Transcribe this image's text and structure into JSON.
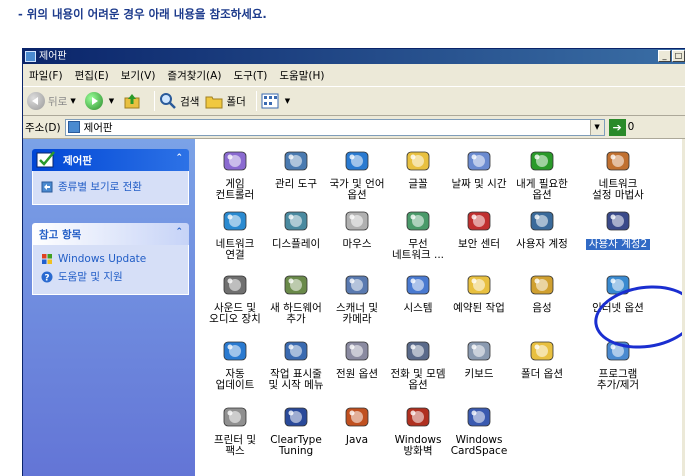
{
  "instruction": "- 위의 내용이 어려운 경우 아래 내용을 참조하세요.",
  "window": {
    "title": "제어판",
    "title_buttons": [
      "_",
      "□"
    ]
  },
  "menubar": [
    "파일(F)",
    "편집(E)",
    "보기(V)",
    "즐겨찾기(A)",
    "도구(T)",
    "도움말(H)"
  ],
  "toolbar": {
    "back": "뒤로",
    "search": "검색",
    "folders": "폴더"
  },
  "address": {
    "label": "주소(D)",
    "value": "제어판",
    "go_label": "0"
  },
  "sidebar": {
    "control_panel": {
      "title": "제어판",
      "links": [
        {
          "label": "종류별 보기로 전환",
          "icon": "category-view-icon"
        }
      ]
    },
    "see_also": {
      "title": "참고 항목",
      "links": [
        {
          "label": "Windows Update",
          "icon": "windows-update-icon"
        },
        {
          "label": "도움말 및 지원",
          "icon": "help-icon"
        }
      ]
    }
  },
  "icons": [
    {
      "label": "게임\n컨트롤러",
      "icon": "game-controller-icon",
      "color": "#8a6ad0"
    },
    {
      "label": "관리 도구",
      "icon": "admin-tools-icon",
      "color": "#4a7ab0"
    },
    {
      "label": "국가 및 언어\n옵션",
      "icon": "globe-icon",
      "color": "#2a7ad0"
    },
    {
      "label": "글꼴",
      "icon": "fonts-folder-icon",
      "color": "#e8c040"
    },
    {
      "label": "날짜 및 시간",
      "icon": "clock-icon",
      "color": "#6a8ad0"
    },
    {
      "label": "내게 필요한\n옵션",
      "icon": "accessibility-icon",
      "color": "#2a9a2a"
    },
    {
      "label": "네트워크\n설정 마법사",
      "icon": "network-setup-icon",
      "color": "#c07030"
    },
    {
      "label": "네트워크\n연결",
      "icon": "network-connections-icon",
      "color": "#2a8ad0"
    },
    {
      "label": "디스플레이",
      "icon": "display-icon",
      "color": "#4a8aa0"
    },
    {
      "label": "마우스",
      "icon": "mouse-icon",
      "color": "#b0b0b0"
    },
    {
      "label": "무선\n네트워크 ...",
      "icon": "wireless-network-icon",
      "color": "#4a9a6a"
    },
    {
      "label": "보안 센터",
      "icon": "security-shield-icon",
      "color": "#c03030"
    },
    {
      "label": "사용자 계정",
      "icon": "user-accounts-icon",
      "color": "#3a6a9a"
    },
    {
      "label": "사용자 계정2",
      "icon": "user-accounts-2-icon",
      "color": "#3a4a8a",
      "selected": true
    },
    {
      "label": "사운드 및\n오디오 장치",
      "icon": "sound-icon",
      "color": "#707070"
    },
    {
      "label": "새 하드웨어\n추가",
      "icon": "add-hardware-icon",
      "color": "#6a8a4a"
    },
    {
      "label": "스캐너 및\n카메라",
      "icon": "scanner-camera-icon",
      "color": "#5a7ab0"
    },
    {
      "label": "시스템",
      "icon": "system-icon",
      "color": "#4a7ad0"
    },
    {
      "label": "예약된 작업",
      "icon": "scheduled-tasks-icon",
      "color": "#e8c040"
    },
    {
      "label": "음성",
      "icon": "speech-icon",
      "color": "#d0a030"
    },
    {
      "label": "인터넷 옵션",
      "icon": "internet-options-icon",
      "color": "#3a8ad0"
    },
    {
      "label": "자동\n업데이트",
      "icon": "auto-update-icon",
      "color": "#2a7ad0"
    },
    {
      "label": "작업 표시줄\n및 시작 메뉴",
      "icon": "taskbar-icon",
      "color": "#3a6ab0"
    },
    {
      "label": "전원 옵션",
      "icon": "power-options-icon",
      "color": "#8a8aa0"
    },
    {
      "label": "전화 및 모뎀\n옵션",
      "icon": "phone-modem-icon",
      "color": "#5a6a8a"
    },
    {
      "label": "키보드",
      "icon": "keyboard-icon",
      "color": "#8a9ab0"
    },
    {
      "label": "폴더 옵션",
      "icon": "folder-options-icon",
      "color": "#e8c040"
    },
    {
      "label": "프로그램\n추가/제거",
      "icon": "add-remove-programs-icon",
      "color": "#4a8ad0"
    },
    {
      "label": "프린터 및\n팩스",
      "icon": "printer-icon",
      "color": "#909090"
    },
    {
      "label": "ClearType\nTuning",
      "icon": "cleartype-icon",
      "color": "#2a4a9a"
    },
    {
      "label": "Java",
      "icon": "java-icon",
      "color": "#c05020"
    },
    {
      "label": "Windows\n방화벽",
      "icon": "firewall-icon",
      "color": "#b03020"
    },
    {
      "label": "Windows\nCardSpace",
      "icon": "cardspace-icon",
      "color": "#3a5ab0"
    }
  ]
}
